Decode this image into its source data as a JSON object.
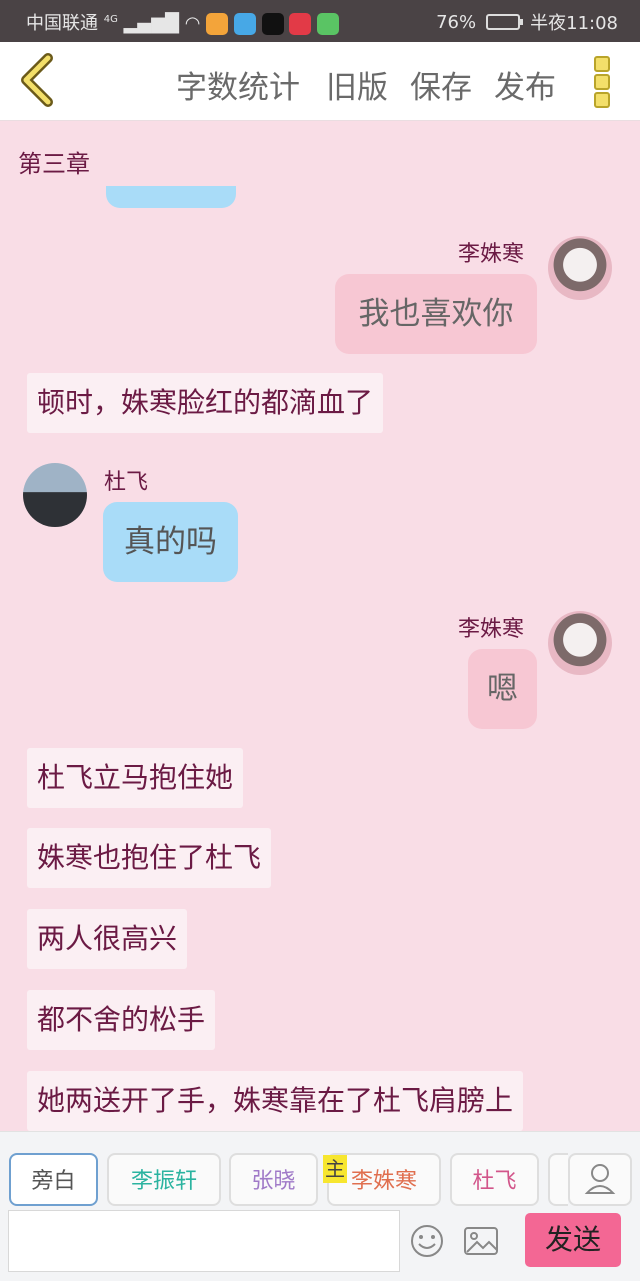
{
  "status_bar": {
    "carrier": "中国联通",
    "network": "4G",
    "battery": "76%",
    "time": "半夜11:08"
  },
  "header": {
    "menu": [
      "字数统计",
      "旧版",
      "保存",
      "发布"
    ]
  },
  "chapter": "第三章",
  "messages": [
    {
      "type": "right",
      "name": "李姝寒",
      "text": "我也喜欢你"
    },
    {
      "type": "narration",
      "text": "顿时，姝寒脸红的都滴血了"
    },
    {
      "type": "left",
      "name": "杜飞",
      "text": "真的吗"
    },
    {
      "type": "right",
      "name": "李姝寒",
      "text": "嗯"
    },
    {
      "type": "narration",
      "text": "杜飞立马抱住她"
    },
    {
      "type": "narration",
      "text": "姝寒也抱住了杜飞"
    },
    {
      "type": "narration",
      "text": "两人很高兴"
    },
    {
      "type": "narration",
      "text": "都不舍的松手"
    },
    {
      "type": "narration",
      "text": "她两送开了手，姝寒靠在了杜飞肩膀上"
    }
  ],
  "roles": [
    {
      "label": "旁白",
      "color": "#555555"
    },
    {
      "label": "李振轩",
      "color": "#2bb3a0"
    },
    {
      "label": "张晓",
      "color": "#a07ac8"
    },
    {
      "label": "李姝寒",
      "color": "#e06f4f",
      "badge": "主"
    },
    {
      "label": "杜飞",
      "color": "#d2558a"
    }
  ],
  "composer": {
    "placeholder": "",
    "send": "发送",
    "icons": [
      "person-icon",
      "emoji-icon",
      "image-icon"
    ]
  },
  "colors": {
    "background": "#f9dde6",
    "accent": "#f36794",
    "narration_text": "#6b1a44"
  }
}
